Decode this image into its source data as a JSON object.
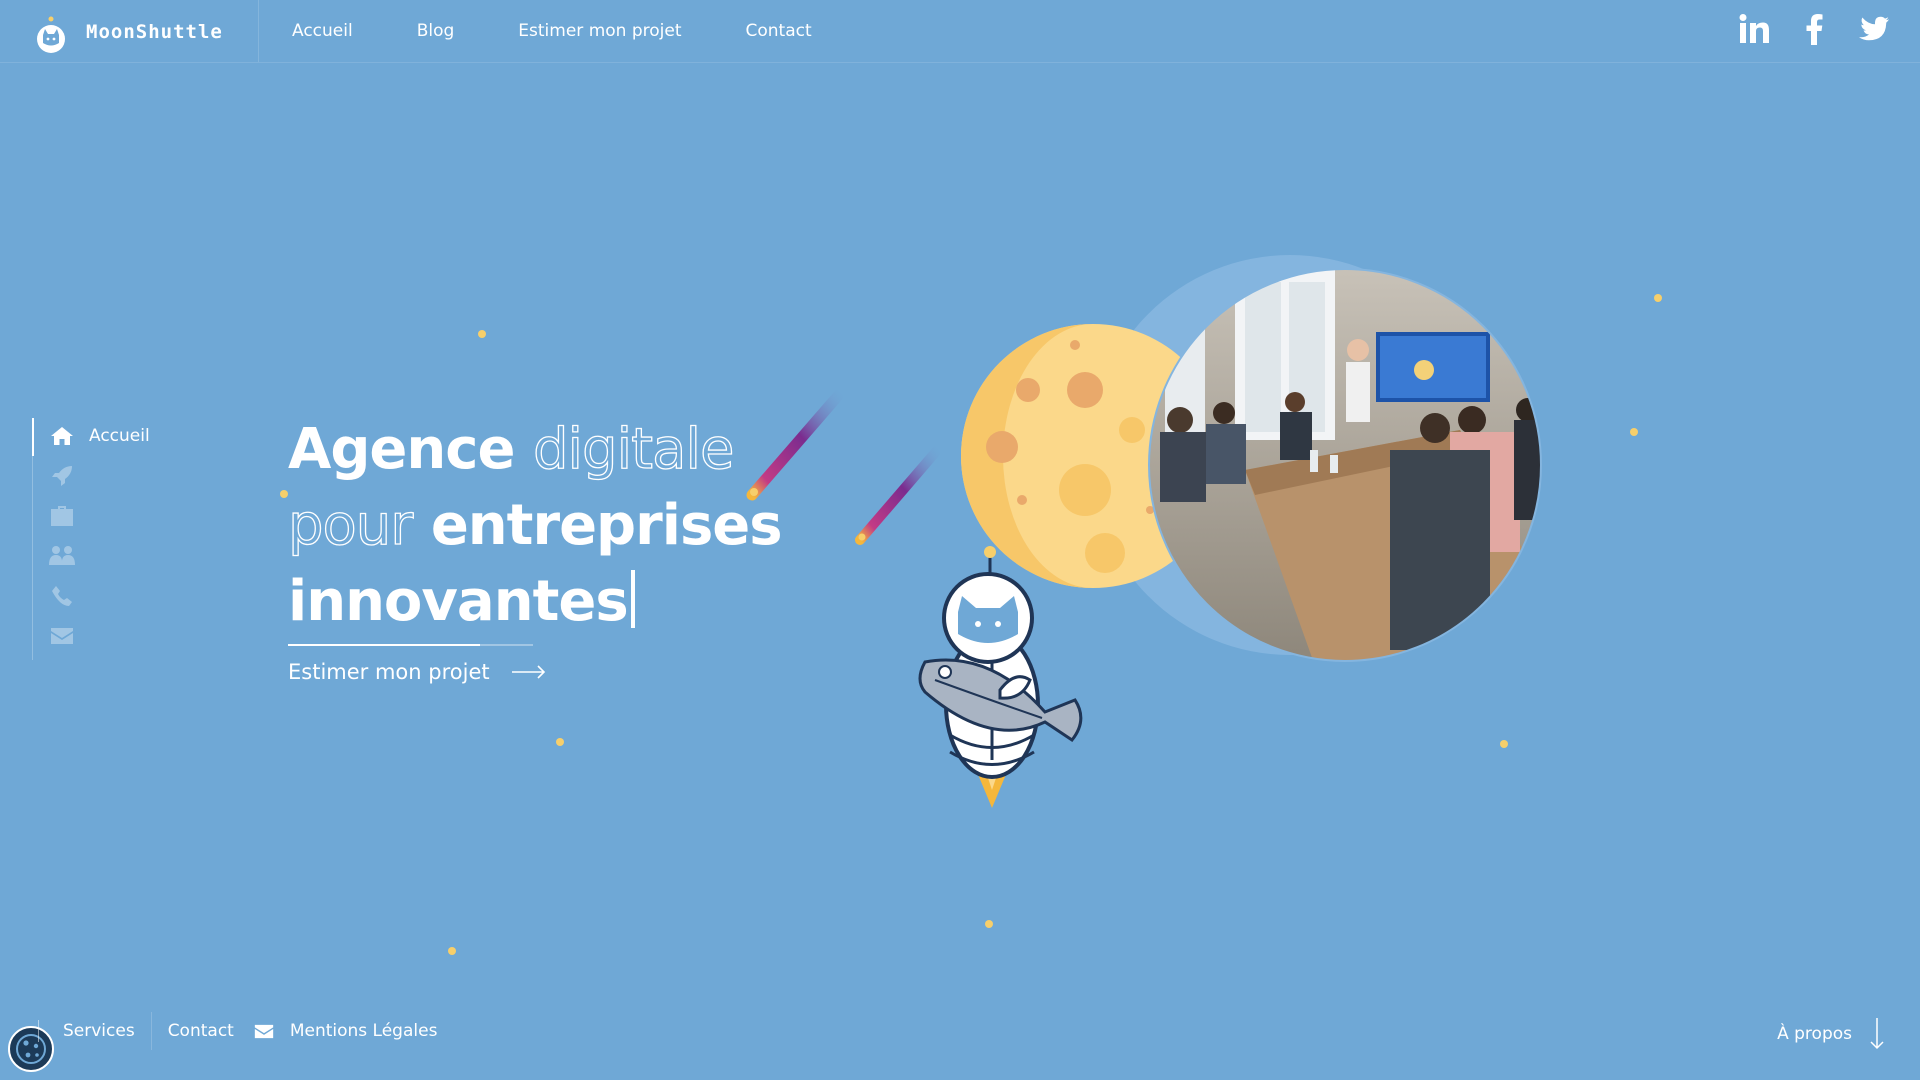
{
  "brand": {
    "name": "MoonShuttle"
  },
  "nav": {
    "items": [
      {
        "label": "Accueil"
      },
      {
        "label": "Blog"
      },
      {
        "label": "Estimer mon projet"
      },
      {
        "label": "Contact"
      }
    ]
  },
  "social": [
    "linkedin-icon",
    "facebook-icon",
    "twitter-icon"
  ],
  "sidenav": {
    "active_label": "Accueil",
    "icons": [
      "home-icon",
      "rocket-icon",
      "briefcase-icon",
      "team-icon",
      "phone-icon",
      "envelope-icon"
    ]
  },
  "hero": {
    "line1_bold": "Agence",
    "line1_outline": "digitale",
    "line2_outline": "pour",
    "line2_bold": "entreprises",
    "line3_bold": "innovantes",
    "cta_label": "Estimer mon projet"
  },
  "footer": {
    "links": {
      "services": "Services",
      "contact": "Contact",
      "legal": "Mentions Légales"
    },
    "about_label": "À propos"
  },
  "colors": {
    "background": "#6fa8d6",
    "moon": "#fbd88a",
    "accent_dot": "#f7cf6b",
    "meteor": "#7b2c8f"
  }
}
